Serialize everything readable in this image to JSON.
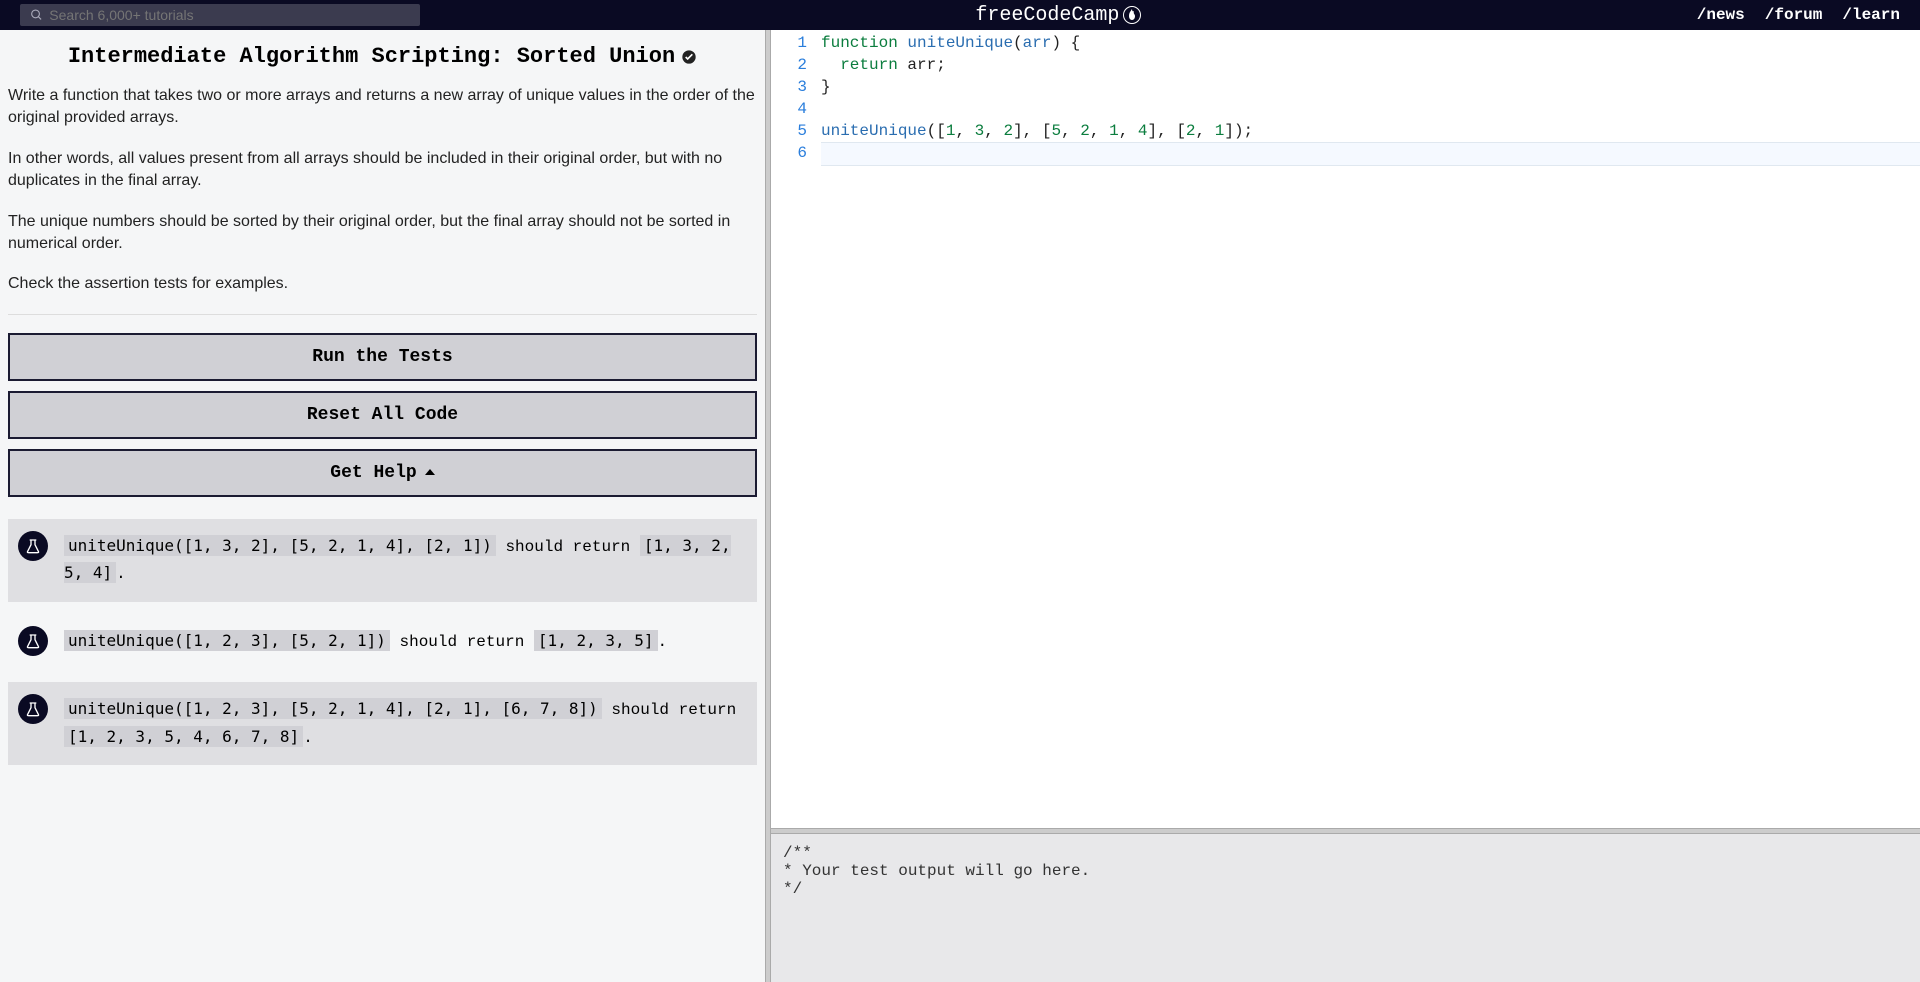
{
  "topbar": {
    "search_placeholder": "Search 6,000+ tutorials",
    "logo_text": "freeCodeCamp",
    "links": {
      "news": "/news",
      "forum": "/forum",
      "learn": "/learn"
    }
  },
  "challenge": {
    "title": "Intermediate Algorithm Scripting: Sorted Union",
    "paragraphs": [
      "Write a function that takes two or more arrays and returns a new array of unique values in the order of the original provided arrays.",
      "In other words, all values present from all arrays should be included in their original order, but with no duplicates in the final array.",
      "The unique numbers should be sorted by their original order, but the final array should not be sorted in numerical order.",
      "Check the assertion tests for examples."
    ]
  },
  "buttons": {
    "run": "Run the Tests",
    "reset": "Reset All Code",
    "help": "Get Help"
  },
  "tests": [
    {
      "call": "uniteUnique([1, 3, 2], [5, 2, 1, 4], [2, 1])",
      "mid": " should return ",
      "ret": "[1, 3, 2, 5, 4]",
      "tail": "."
    },
    {
      "call": "uniteUnique([1, 2, 3], [5, 2, 1])",
      "mid": " should return ",
      "ret": "[1, 2, 3, 5]",
      "tail": "."
    },
    {
      "call": "uniteUnique([1, 2, 3], [5, 2, 1, 4], [2, 1], [6, 7, 8])",
      "mid": " should return ",
      "ret": "[1, 2, 3, 5, 4, 6, 7, 8]",
      "tail": "."
    }
  ],
  "editor": {
    "line_numbers": [
      "1",
      "2",
      "3",
      "4",
      "5",
      "6"
    ],
    "lines": {
      "l1_kw": "function",
      "l1_fn": "uniteUnique",
      "l1_p1": "(",
      "l1_arg": "arr",
      "l1_p2": ") {",
      "l2_kw": "return",
      "l2_rest": " arr;",
      "l3": "}",
      "l4": "",
      "l5_fn": "uniteUnique",
      "l5_a": "([",
      "l5_n1": "1",
      "l5_c1": ", ",
      "l5_n2": "3",
      "l5_c2": ", ",
      "l5_n3": "2",
      "l5_b": "], [",
      "l5_n4": "5",
      "l5_c3": ", ",
      "l5_n5": "2",
      "l5_c4": ", ",
      "l5_n6": "1",
      "l5_c5": ", ",
      "l5_n7": "4",
      "l5_d": "], [",
      "l5_n8": "2",
      "l5_c6": ", ",
      "l5_n9": "1",
      "l5_e": "]);",
      "l6": ""
    }
  },
  "output": {
    "text": "/**\n* Your test output will go here.\n*/"
  }
}
